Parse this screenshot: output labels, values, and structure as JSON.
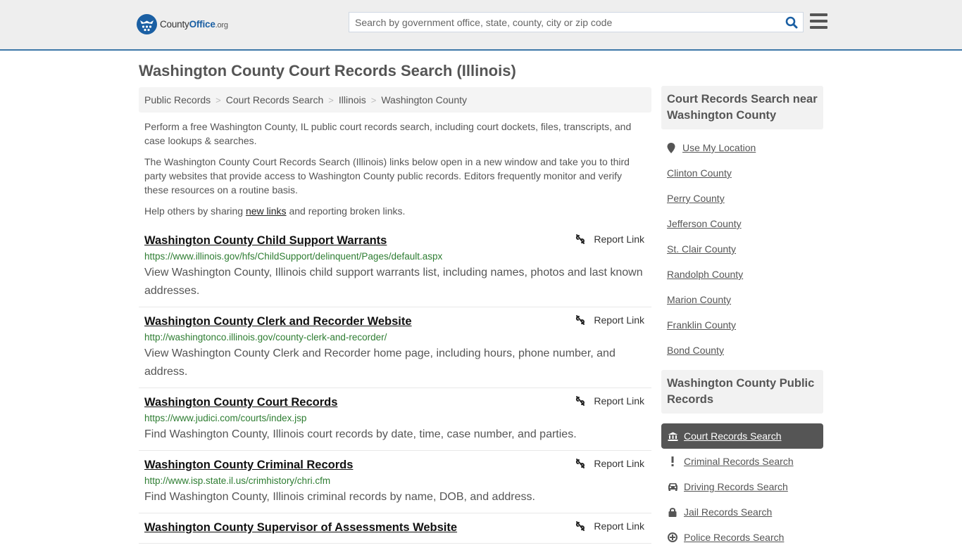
{
  "header": {
    "logo": {
      "part1": "County",
      "part2": "Office",
      "part3": ".org"
    },
    "search_placeholder": "Search by government office, state, county, city or zip code",
    "search_value": "",
    "accent_color": "#1a5fa3",
    "border_color": "#3d78a8"
  },
  "page": {
    "title": "Washington County Court Records Search (Illinois)"
  },
  "breadcrumb": [
    {
      "label": "Public Records"
    },
    {
      "label": "Court Records Search"
    },
    {
      "label": "Illinois"
    },
    {
      "label": "Washington County"
    }
  ],
  "intro": {
    "p1": "Perform a free Washington County, IL public court records search, including court dockets, files, transcripts, and case lookups & searches.",
    "p2": "The Washington County Court Records Search (Illinois) links below open in a new window and take you to third party websites that provide access to Washington County public records. Editors frequently monitor and verify these resources on a routine basis.",
    "p3_before": "Help others by sharing ",
    "p3_link": "new links",
    "p3_after": " and reporting broken links."
  },
  "report_label": "Report Link",
  "results": [
    {
      "title": "Washington County Child Support Warrants",
      "url": "https://www.illinois.gov/hfs/ChildSupport/delinquent/Pages/default.aspx",
      "description": "View Washington County, Illinois child support warrants list, including names, photos and last known addresses."
    },
    {
      "title": "Washington County Clerk and Recorder Website",
      "url": "http://washingtonco.illinois.gov/county-clerk-and-recorder/",
      "description": "View Washington County Clerk and Recorder home page, including hours, phone number, and address."
    },
    {
      "title": "Washington County Court Records",
      "url": "https://www.judici.com/courts/index.jsp",
      "description": "Find Washington County, Illinois court records by date, time, case number, and parties."
    },
    {
      "title": "Washington County Criminal Records",
      "url": "http://www.isp.state.il.us/crimhistory/chri.cfm",
      "description": "Find Washington County, Illinois criminal records by name, DOB, and address."
    },
    {
      "title": "Washington County Supervisor of Assessments Website",
      "url": "",
      "description": ""
    }
  ],
  "sidebar": {
    "near_heading": "Court Records Search near Washington County",
    "use_location": "Use My Location",
    "near_counties": [
      "Clinton County",
      "Perry County",
      "Jefferson County",
      "St. Clair County",
      "Randolph County",
      "Marion County",
      "Franklin County",
      "Bond County"
    ],
    "public_records_heading": "Washington County Public Records",
    "public_records": [
      {
        "label": "Court Records Search",
        "icon": "courthouse-icon",
        "active": true
      },
      {
        "label": "Criminal Records Search",
        "icon": "exclamation-icon",
        "active": false
      },
      {
        "label": "Driving Records Search",
        "icon": "car-icon",
        "active": false
      },
      {
        "label": "Jail Records Search",
        "icon": "lock-icon",
        "active": false
      },
      {
        "label": "Police Records Search",
        "icon": "police-badge-icon",
        "active": false
      }
    ]
  }
}
